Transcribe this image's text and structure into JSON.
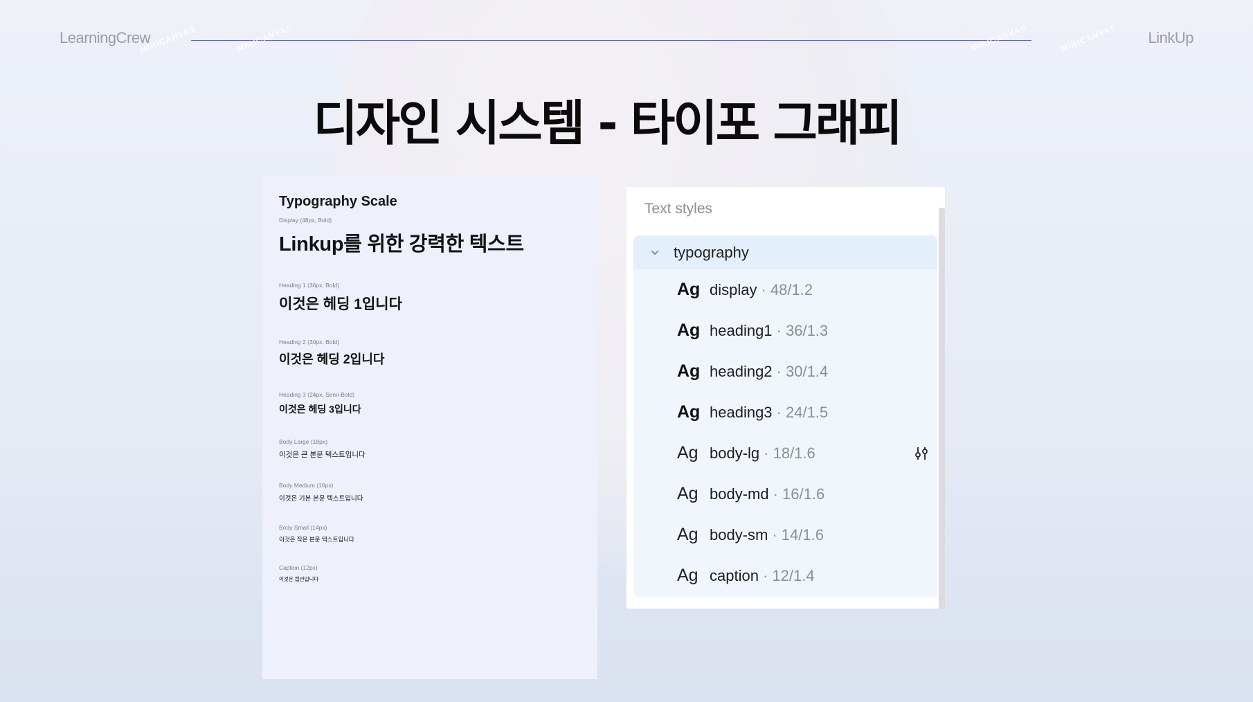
{
  "header": {
    "brand_left": "LearningCrew",
    "brand_right": "LinkUp",
    "watermark": "MIRICANVAS"
  },
  "title": "디자인 시스템 - 타이포 그래피",
  "scale_card": {
    "heading": "Typography Scale",
    "items": [
      {
        "label": "Display (48px, Bold)",
        "sample": "Linkup를 위한 강력한 텍스트"
      },
      {
        "label": "Heading 1 (36px, Bold)",
        "sample": "이것은 헤딩 1입니다"
      },
      {
        "label": "Heading 2 (30px, Bold)",
        "sample": "이것은 헤딩 2입니다"
      },
      {
        "label": "Heading 3 (24px, Semi-Bold)",
        "sample": "이것은 헤딩 3입니다"
      },
      {
        "label": "Body Large (18px)",
        "sample": "이것은 큰 본문 텍스트입니다"
      },
      {
        "label": "Body Medium (16px)",
        "sample": "이것은 기본 본문 텍스트입니다"
      },
      {
        "label": "Body Small (14px)",
        "sample": "이것은 작은 본문 텍스트입니다"
      },
      {
        "label": "Caption (12px)",
        "sample": "이것은 캡션입니다"
      }
    ]
  },
  "styles_panel": {
    "title": "Text styles",
    "group": "typography",
    "preview_glyph": "Ag",
    "styles": [
      {
        "name": "display",
        "meta": "· 48/1.2"
      },
      {
        "name": "heading1",
        "meta": "· 36/1.3"
      },
      {
        "name": "heading2",
        "meta": "· 30/1.4"
      },
      {
        "name": "heading3",
        "meta": "· 24/1.5"
      },
      {
        "name": "body-lg",
        "meta": "· 18/1.6"
      },
      {
        "name": "body-md",
        "meta": "· 16/1.6"
      },
      {
        "name": "body-sm",
        "meta": "· 14/1.6"
      },
      {
        "name": "caption",
        "meta": "· 12/1.4"
      }
    ]
  }
}
